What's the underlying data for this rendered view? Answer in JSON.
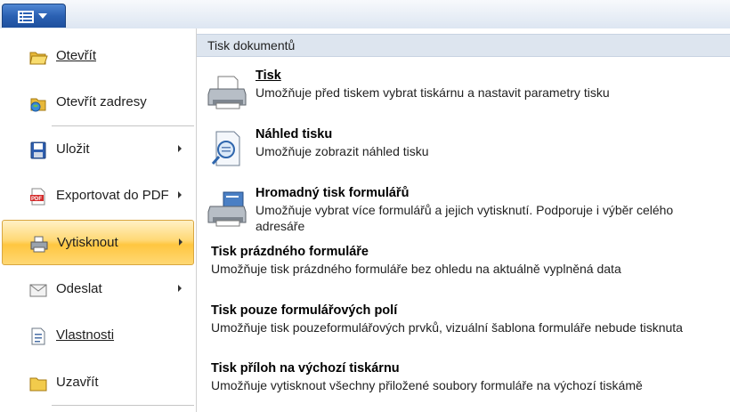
{
  "left_menu": {
    "items": [
      {
        "label": "Otevřít",
        "icon": "folder-open-icon",
        "submenu": false
      },
      {
        "label": "Otevřít zadresy",
        "icon": "open-from-address-icon",
        "submenu": false
      },
      {
        "label": "Uložit",
        "icon": "save-disk-icon",
        "submenu": true
      },
      {
        "label": "Exportovat do PDF",
        "icon": "pdf-icon",
        "submenu": true
      },
      {
        "label": "Vytisknout",
        "icon": "printer-icon",
        "submenu": true,
        "selected": true
      },
      {
        "label": "Odeslat",
        "icon": "envelope-icon",
        "submenu": true
      },
      {
        "label": "Vlastnosti",
        "icon": "properties-icon",
        "submenu": false
      },
      {
        "label": "Uzavřít",
        "icon": "folder-close-icon",
        "submenu": false
      }
    ]
  },
  "right_panel": {
    "header": "Tisk dokumentů",
    "options": [
      {
        "title": "Tisk",
        "description": "Umožňuje před tiskem vybrat tiskárnu a nastavit parametry tisku",
        "icon": "printer-large-icon"
      },
      {
        "title": "Náhled tisku",
        "description": "Umožňuje zobrazit náhled tisku",
        "icon": "print-preview-icon"
      },
      {
        "title": "Hromadný tisk formulářů",
        "description": "Umožňuje vybrat více formulářů a jejich vytisknutí. Podporuje i výběr celého adresáře",
        "icon": "batch-print-icon"
      },
      {
        "title": "Tisk prázdného formuláře",
        "description": "Umožňuje tisk prázdného formuláře bez ohledu na aktuálně vyplněná data"
      },
      {
        "title": "Tisk pouze formulářových polí",
        "description": "Umožňuje tisk pouzeformulářových prvků, vizuální šablona formuláře nebude tisknuta"
      },
      {
        "title": "Tisk příloh na výchozí tiskárnu",
        "description": "Umožňuje vytisknout všechny přiložené soubory formuláře na výchozí tiskámě"
      }
    ]
  },
  "colors": {
    "app_button": "#2b61b3",
    "selected_item": "#ffd874",
    "header_bg": "#dde5ef"
  }
}
